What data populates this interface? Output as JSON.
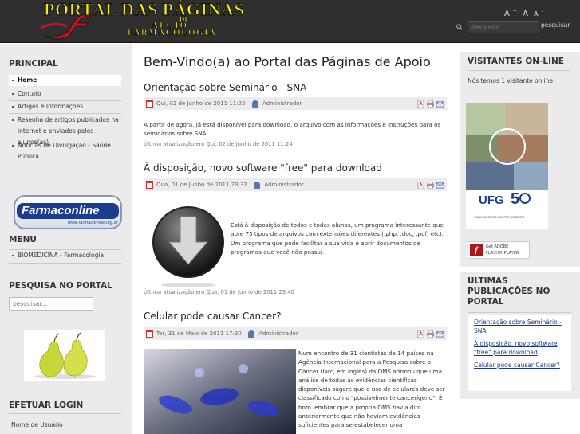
{
  "header": {
    "logo_line1": "PORTAL DAS PÁGINAS",
    "logo_line2": "DE",
    "logo_line3": "APOIO",
    "logo_line4": "FARMACOLOGIA",
    "font_large": "A",
    "font_reset": "A",
    "font_small": "A",
    "search_placeholder": "pesquisar...",
    "search_button": "pesquisar"
  },
  "left": {
    "principal_title": "PRINCIPAL",
    "principal_items": [
      "Home",
      "Contato",
      "Artigos e Informações",
      "Resenha de artigos publicados na internet e enviados pelos alunos(as)",
      "Notícias de Divulgação - Saúde Pública"
    ],
    "banner_text": "Farmaconline",
    "banner_url": "www.farmaconline.ufg.br",
    "menu_title": "MENU",
    "menu_items": [
      "BIOMEDICINA - Farmacologia"
    ],
    "search_title": "PESQUISA NO PORTAL",
    "search_placeholder": "pesquisar...",
    "login_title": "EFETUAR LOGIN",
    "login_username_label": "Nome de Usuário"
  },
  "main": {
    "page_title": "Bem-Vindo(a) ao Portal das Páginas de Apoio",
    "articles": [
      {
        "title": "Orientação sobre Seminário - SNA",
        "date": "Qui, 02 de Junho de 2011 11:22",
        "author": "Administrador",
        "body": "A partir de agora, já está disponível para download, o arquivo com as informações e instruções para os seminários sobre SNA",
        "updated": "Última atualização em Qui, 02 de Junho de 2011 11:24"
      },
      {
        "title": "À disposição, novo software \"free\" para download",
        "date": "Qua, 01 de Junho de 2011 23:32",
        "author": "Administrador",
        "body": "Está à disposição de todos e todas alunas, um programa interessante que abre 75 tipos de arquivos com extensões diferentes (.php, .doc, .pdf, etc). Um programa que pode facilitar a sua vida e abrir documentos de programas que você não possui.",
        "updated": "Última atualização em Qua, 01 de Junho de 2011 23:40"
      },
      {
        "title": "Celular pode causar Cancer?",
        "date": "Ter, 31 de Maio de 2011 17:30",
        "author": "Administrador",
        "body": "Num encontro de 31 cientistas de 14 países na Agência Internacional para a Pesquisa sobre o Câncer (Iarc, em inglês) da OMS afirmou que uma análise de todas as evidências científicas disponíveis sugere que o uso de celulares deve ser classificado como \"possivelmente cancerígeno\". É bom lembrar que a própria OMS havia dito anteriormente que não haviam evidências suficientes para se estabelecer uma"
      }
    ]
  },
  "right": {
    "visitors_title": "VISITANTES ON-LINE",
    "visitors_text": "Nós temos 1 visitante online",
    "ufg_text": "UFG",
    "ufg_slogan": "CONHECIMENTO SEMPRE PRESENTE",
    "flash_get": "Get ADOBE",
    "flash_player": "FLASH® PLAYER",
    "latest_title": "ÚLTIMAS PUBLICAÇÕES NO PORTAL",
    "latest_items": [
      "Orientação sobre Seminário - SNA",
      "À disposição, novo software \"free\" para download",
      "Celular pode causar Cancer?"
    ]
  },
  "colors": {
    "header_bg": "#2f2f2f",
    "logo_yellow": "#f6e61a",
    "sidebar_bg": "#ebebeb",
    "link": "#1a3a8a"
  }
}
